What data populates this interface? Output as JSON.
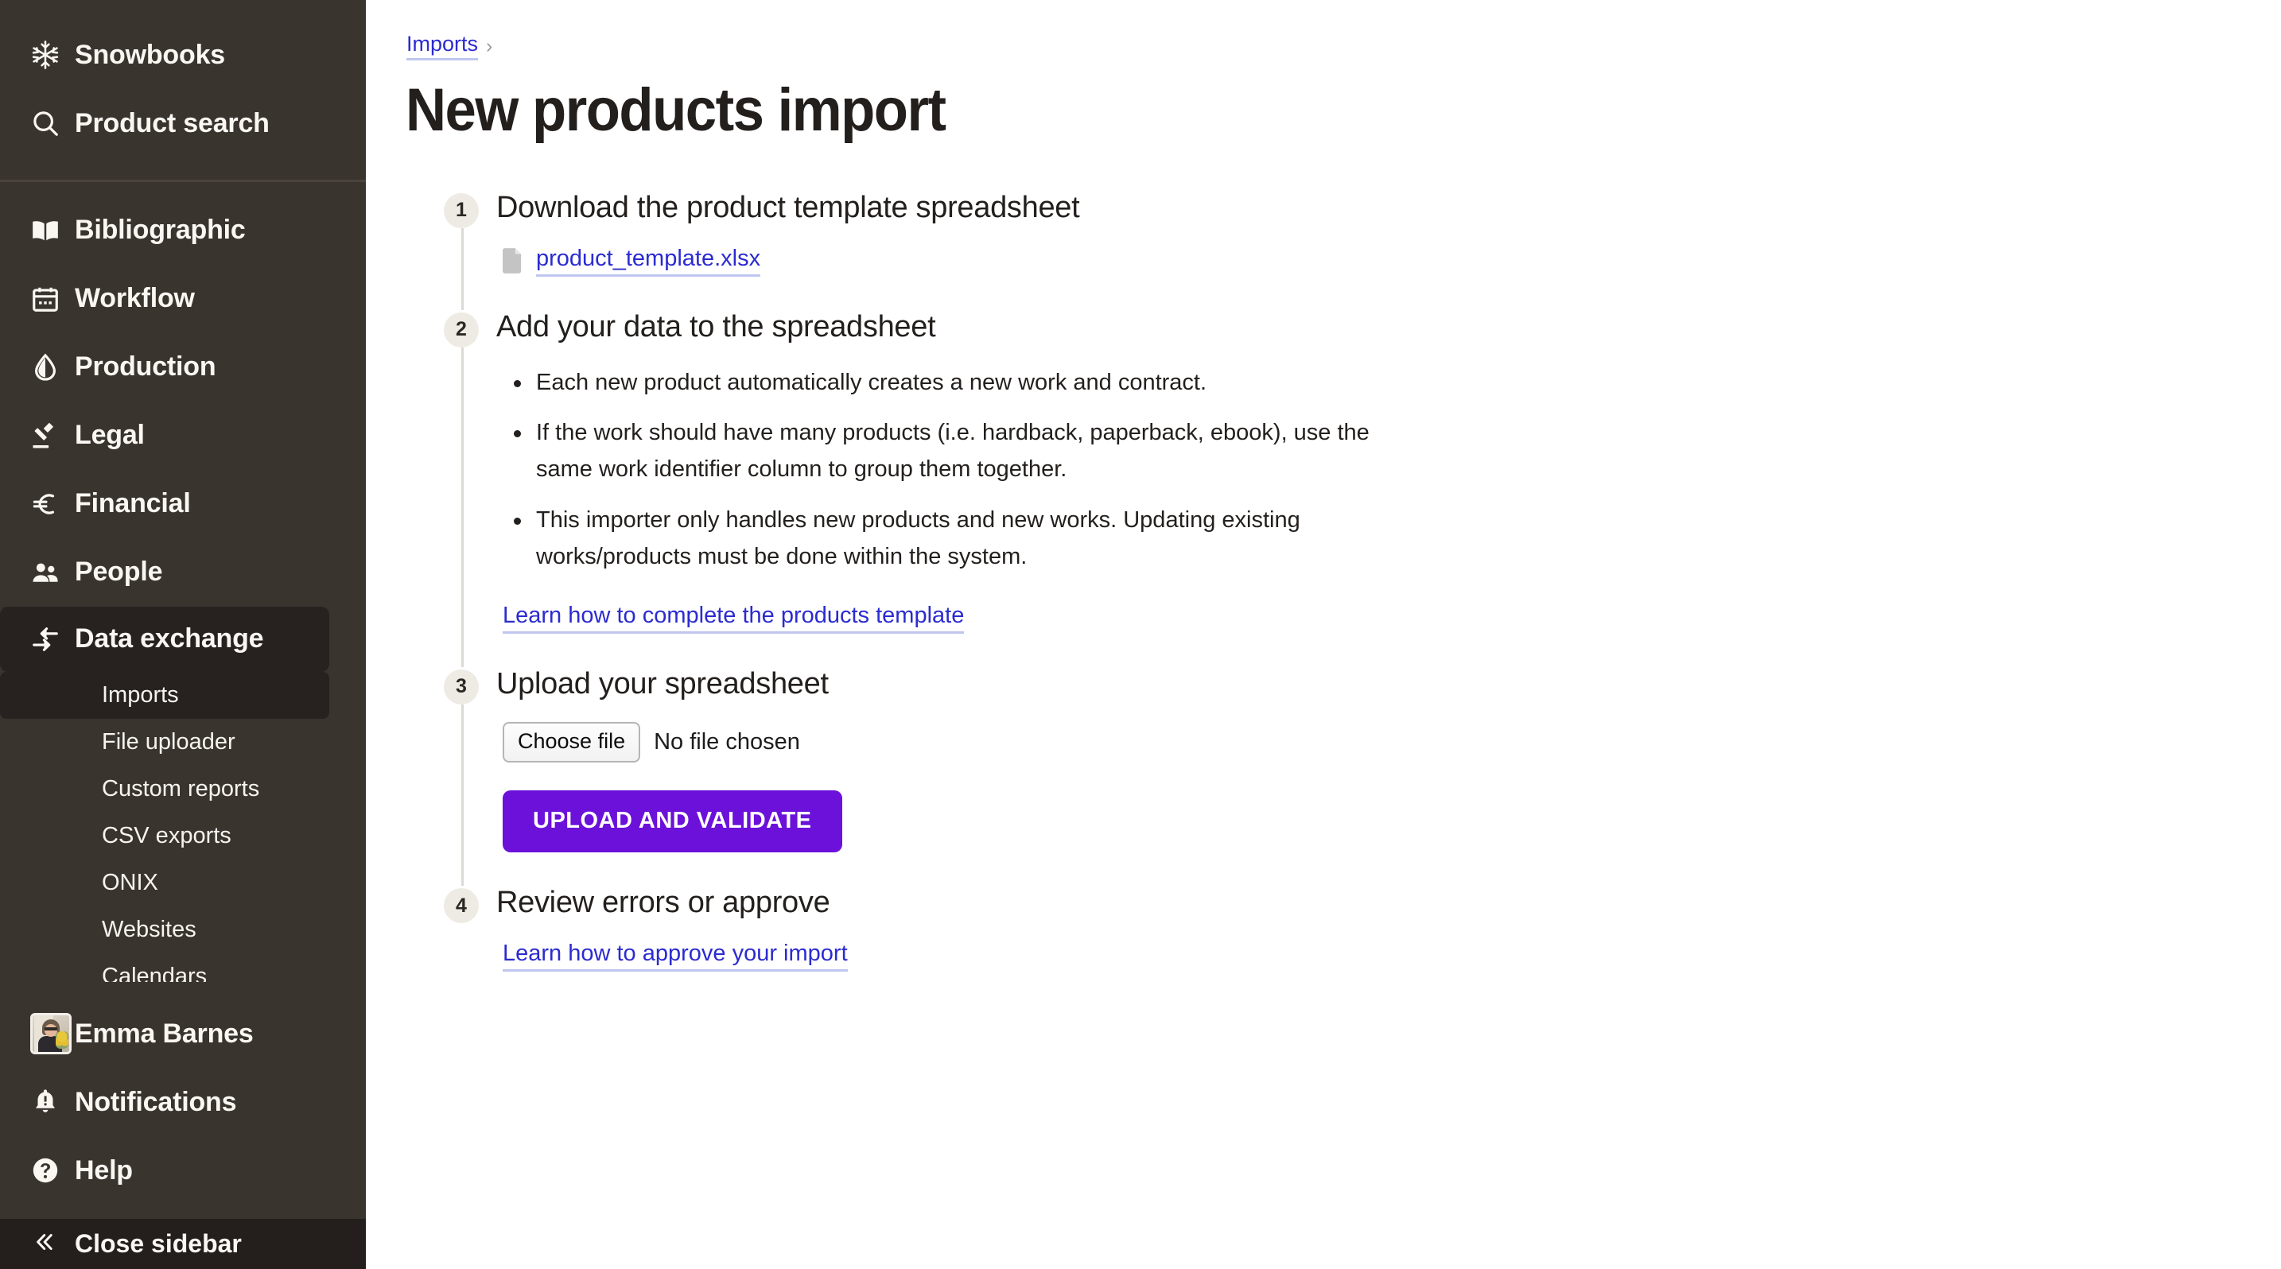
{
  "sidebar": {
    "top_items": [
      {
        "label": "Snowbooks",
        "icon": "snowflake-icon"
      },
      {
        "label": "Product search",
        "icon": "search-icon"
      }
    ],
    "nav_items": [
      {
        "label": "Bibliographic",
        "icon": "book-icon"
      },
      {
        "label": "Workflow",
        "icon": "calendar-icon"
      },
      {
        "label": "Production",
        "icon": "droplet-icon"
      },
      {
        "label": "Legal",
        "icon": "gavel-icon"
      },
      {
        "label": "Financial",
        "icon": "euro-icon"
      },
      {
        "label": "People",
        "icon": "people-icon"
      }
    ],
    "active_group": {
      "label": "Data exchange",
      "icon": "data-exchange-icon"
    },
    "sub_items": [
      {
        "label": "Imports",
        "active": true
      },
      {
        "label": "File uploader",
        "active": false
      },
      {
        "label": "Custom reports",
        "active": false
      },
      {
        "label": "CSV exports",
        "active": false
      },
      {
        "label": "ONIX",
        "active": false
      },
      {
        "label": "Websites",
        "active": false
      },
      {
        "label": "Calendars",
        "active": false
      }
    ],
    "bottom_items": [
      {
        "label": "Emma Barnes",
        "icon": "avatar"
      },
      {
        "label": "Notifications",
        "icon": "bell-alert-icon"
      },
      {
        "label": "Help",
        "icon": "question-circle-icon"
      }
    ],
    "footer": {
      "label": "Close sidebar",
      "icon": "chevron-double-left-icon"
    },
    "colors": {
      "background": "#3a342f",
      "active_background": "#272220",
      "footer_background": "#241f1c",
      "text": "#faf7f3"
    }
  },
  "breadcrumb": {
    "parent": "Imports",
    "separator": "›"
  },
  "page": {
    "title": "New products import"
  },
  "steps": [
    {
      "number": "1",
      "title": "Download the product template spreadsheet",
      "file_link": "product_template.xlsx"
    },
    {
      "number": "2",
      "title": "Add your data to the spreadsheet",
      "bullets": [
        "Each new product automatically creates a new work and contract.",
        "If the work should have many products (i.e. hardback, paperback, ebook), use the same work identifier column to group them together.",
        "This importer only handles new products and new works. Updating existing works/products must be done within the system."
      ],
      "learn_link": "Learn how to complete the products template"
    },
    {
      "number": "3",
      "title": "Upload your spreadsheet",
      "choose_file_label": "Choose file",
      "no_file_label": "No file chosen",
      "upload_button": "UPLOAD AND VALIDATE"
    },
    {
      "number": "4",
      "title": "Review errors or approve",
      "learn_link": "Learn how to approve your import"
    }
  ],
  "colors": {
    "accent_purple": "#6b11da",
    "link_blue": "#2b2bd0",
    "badge_grey": "#eeebe4"
  }
}
